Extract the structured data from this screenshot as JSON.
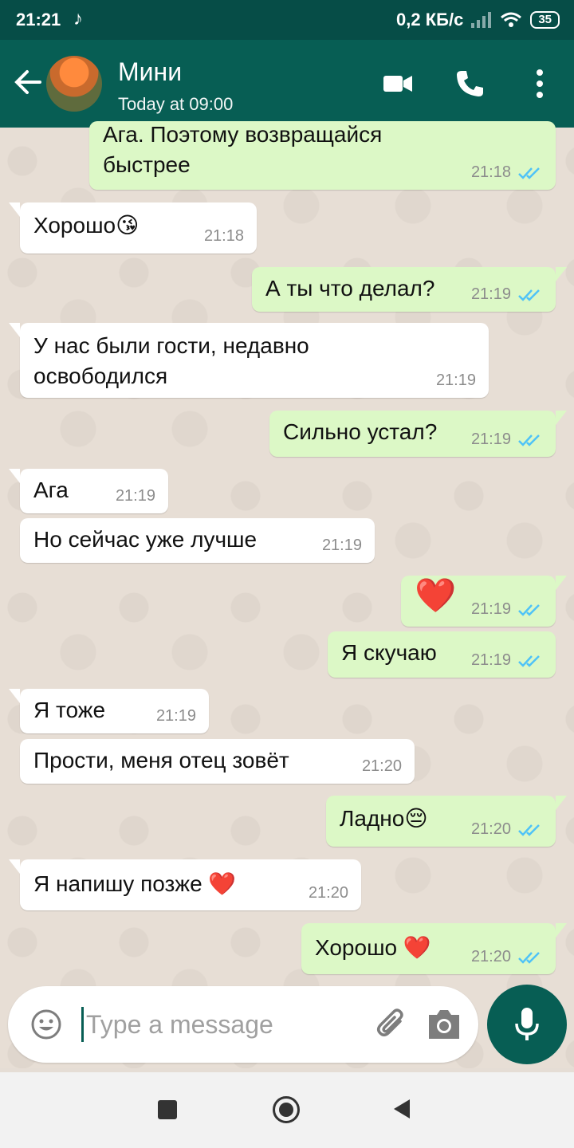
{
  "status_bar": {
    "time": "21:21",
    "network_speed": "0,2 КБ/с",
    "battery": "35"
  },
  "header": {
    "contact_name": "Мини",
    "last_seen": "Today at 09:00"
  },
  "messages": [
    {
      "direction": "out",
      "text": "Ага. Поэтому возвращайся\nбыстрее",
      "time": "21:18",
      "read": true
    },
    {
      "direction": "in",
      "text": "Хорошо😘",
      "time": "21:18"
    },
    {
      "direction": "out",
      "text": "А ты что делал?",
      "time": "21:19",
      "read": true
    },
    {
      "direction": "in",
      "text": "У нас были гости, недавно\nосвободился",
      "time": "21:19"
    },
    {
      "direction": "out",
      "text": "Сильно устал?",
      "time": "21:19",
      "read": true
    },
    {
      "direction": "in",
      "text": "Ага",
      "time": "21:19"
    },
    {
      "direction": "in",
      "text": "Но сейчас уже лучше",
      "time": "21:19"
    },
    {
      "direction": "out",
      "text": "❤️",
      "time": "21:19",
      "read": true
    },
    {
      "direction": "out",
      "text": "Я скучаю",
      "time": "21:19",
      "read": true
    },
    {
      "direction": "in",
      "text": "Я тоже",
      "time": "21:19"
    },
    {
      "direction": "in",
      "text": "Прости, меня отец зовёт",
      "time": "21:20"
    },
    {
      "direction": "out",
      "text": "Ладно😔",
      "time": "21:20",
      "read": true
    },
    {
      "direction": "in",
      "text": "Я напишу позже ❤️",
      "time": "21:20"
    },
    {
      "direction": "out",
      "text": "Хорошо ❤️",
      "time": "21:20",
      "read": true
    }
  ],
  "composer": {
    "placeholder": "Type a message"
  },
  "colors": {
    "header": "#075e54",
    "status_bar": "#064d47",
    "outgoing_bubble": "#dcf8c6",
    "incoming_bubble": "#ffffff",
    "read_ticks": "#4fc3f7"
  }
}
